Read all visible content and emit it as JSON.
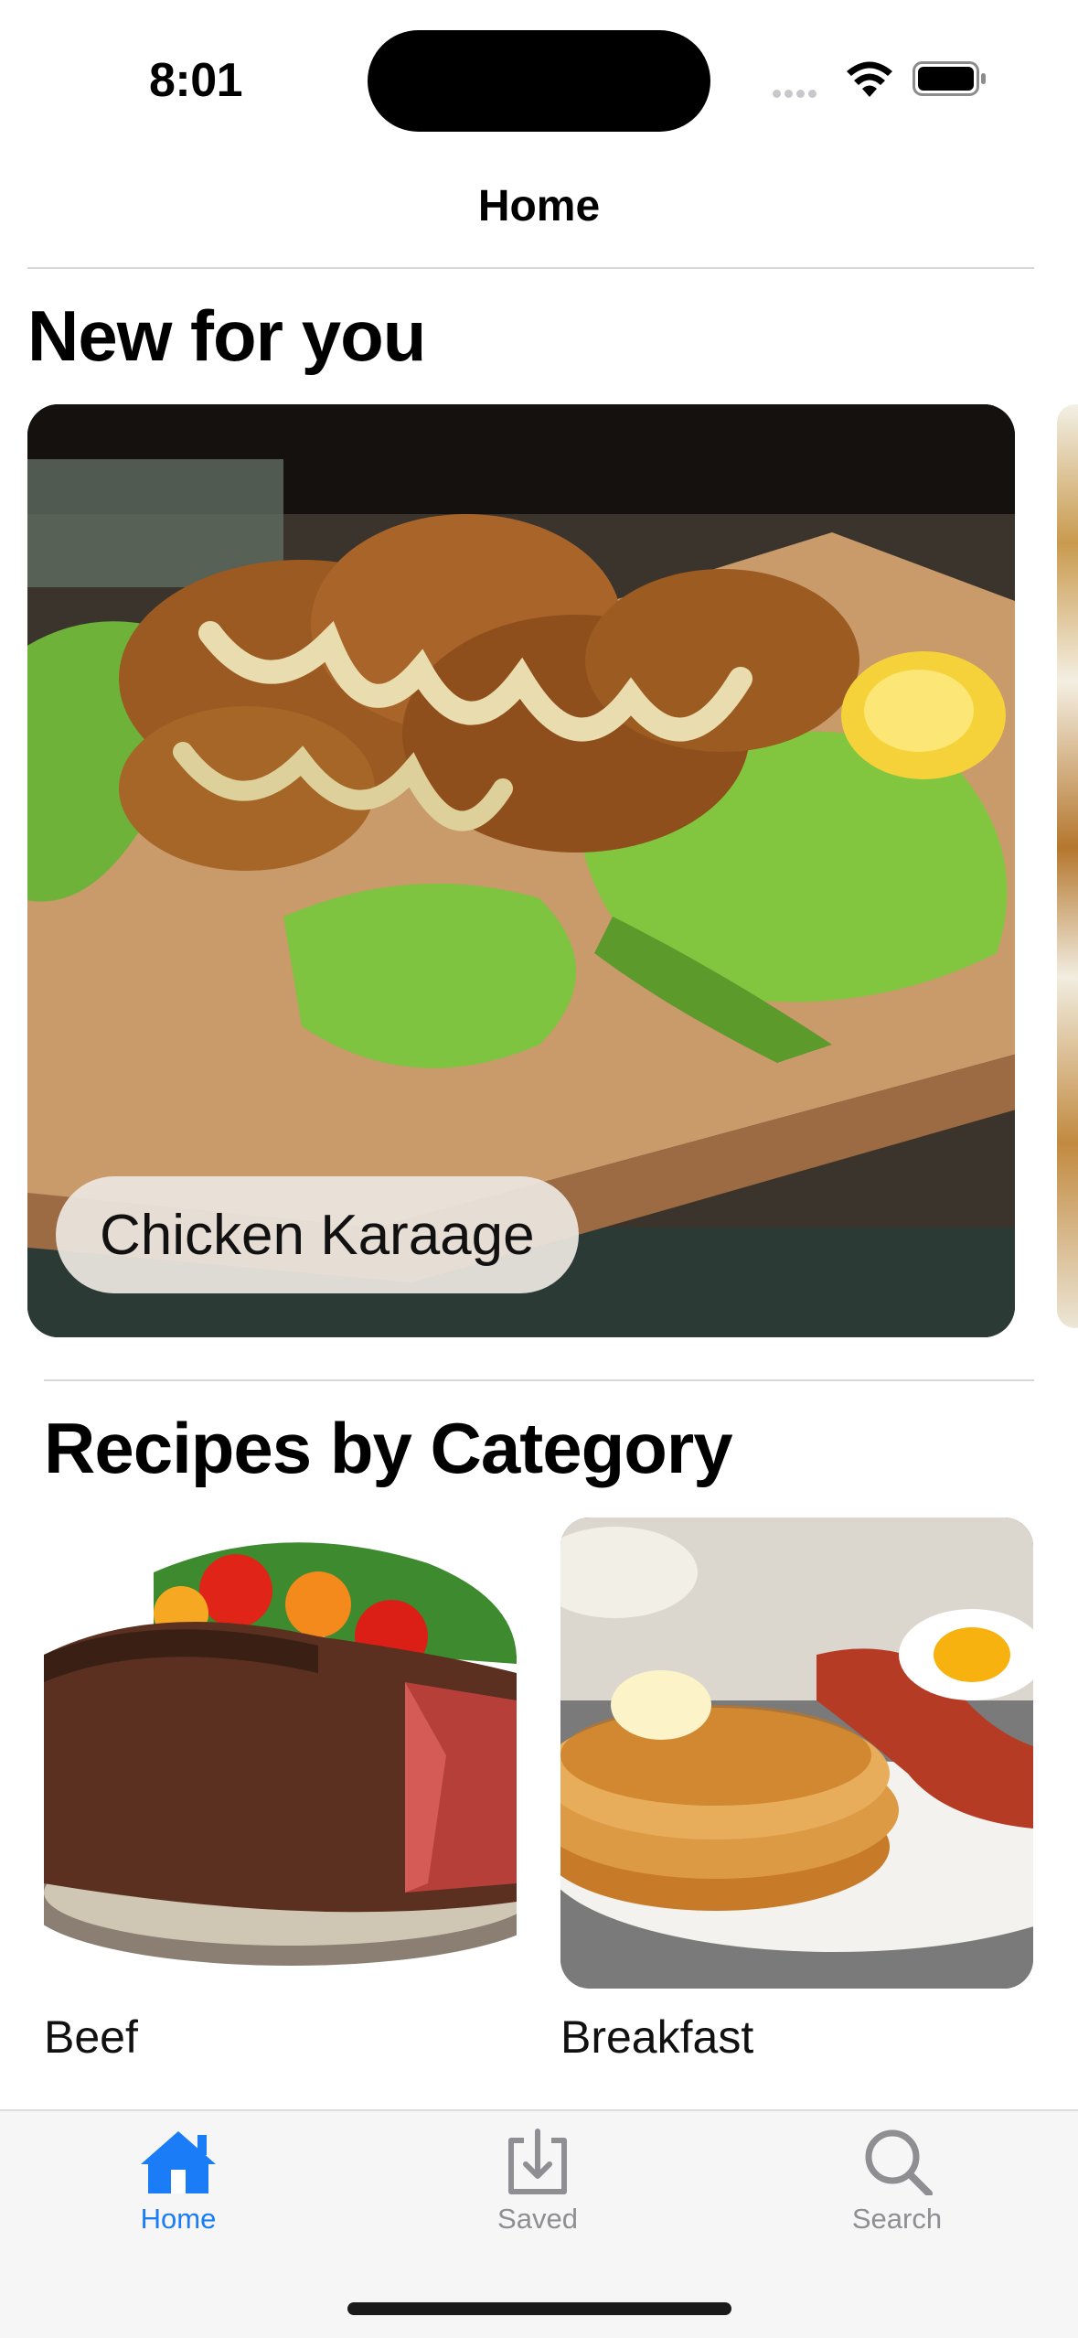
{
  "status_bar": {
    "time": "8:01"
  },
  "nav": {
    "title": "Home"
  },
  "featured": {
    "heading": "New for you",
    "items": [
      {
        "name": "Chicken Karaage"
      }
    ]
  },
  "categories": {
    "heading": "Recipes by Category",
    "items": [
      {
        "name": "Beef"
      },
      {
        "name": "Breakfast"
      }
    ]
  },
  "tab_bar": {
    "tabs": [
      {
        "label": "Home",
        "icon": "house-icon",
        "selected": true
      },
      {
        "label": "Saved",
        "icon": "download-tray-icon",
        "selected": false
      },
      {
        "label": "Search",
        "icon": "magnifier-icon",
        "selected": false
      }
    ],
    "accent": "#1a7cf6",
    "inactive": "#8e8e93"
  }
}
